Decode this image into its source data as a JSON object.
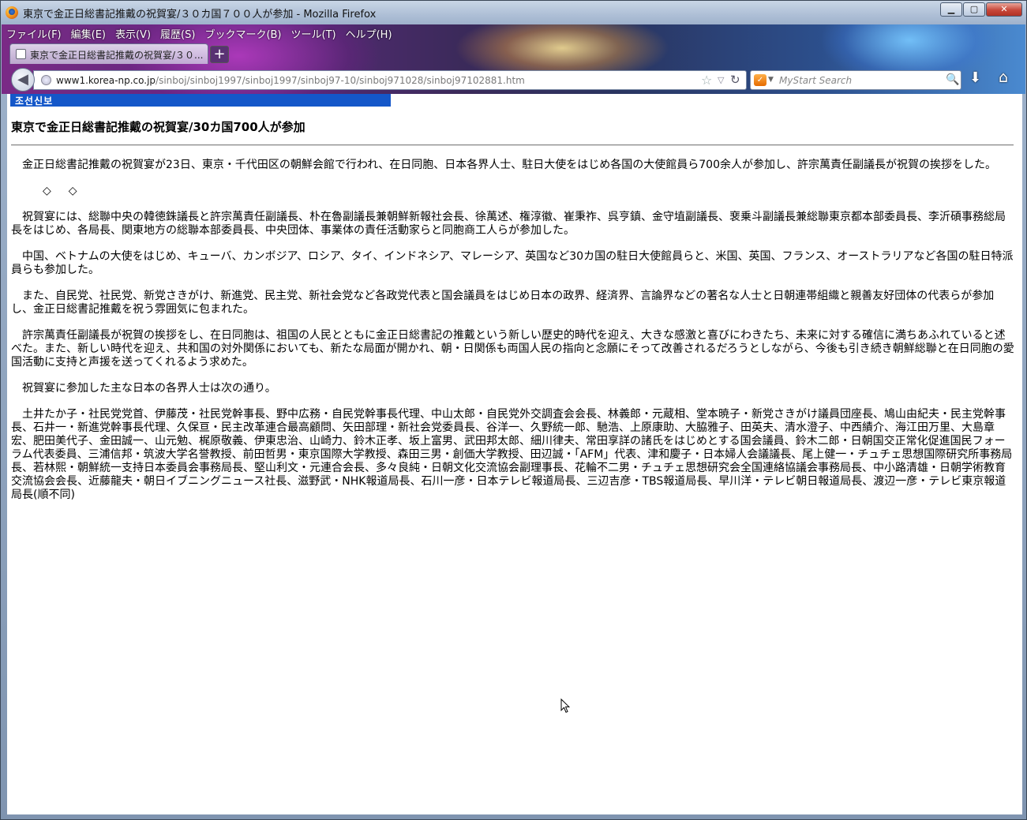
{
  "window": {
    "title": "東京で金正日総書記推戴の祝賀宴/３０カ国７００人が参加 - Mozilla Firefox",
    "minimize_glyph": "▁",
    "maximize_glyph": "▢",
    "close_glyph": "✕"
  },
  "menubar": {
    "items": [
      "ファイル(F)",
      "編集(E)",
      "表示(V)",
      "履歴(S)",
      "ブックマーク(B)",
      "ツール(T)",
      "ヘルプ(H)"
    ]
  },
  "tabs": [
    {
      "label": "東京で金正日総書記推戴の祝賀宴/３０...",
      "active": true
    }
  ],
  "newtab_glyph": "+",
  "navbar": {
    "back_glyph": "◀",
    "url_host": "www1.korea-np.co.jp",
    "url_path": "/sinboj/sinboj1997/sinboj1997/sinboj97-10/sinboj971028/sinboj97102881.htm",
    "search_placeholder": "MyStart Search",
    "search_engine_glyph": "✓",
    "star_glyph": "☆",
    "dropdown_glyph": "▽",
    "reload_glyph": "↻",
    "search_go_glyph": "🔍",
    "download_glyph": "⬇",
    "home_glyph": "⌂"
  },
  "page": {
    "masthead": "조선신보",
    "headline": "東京で金正日総書記推戴の祝賀宴/30カ国700人が参加",
    "paragraphs": [
      "金正日総書記推戴の祝賀宴が23日、東京・千代田区の朝鮮会館で行われ、在日同胞、日本各界人士、駐日大使をはじめ各国の大使館員ら700余人が参加し、許宗萬責任副議長が祝賀の挨拶をした。",
      "◇◇",
      "祝賀宴には、総聯中央の韓徳銖議長と許宗萬責任副議長、朴在魯副議長兼朝鮮新報社会長、徐萬述、権淳徽、崔秉祚、呉亨鎮、金守埴副議長、裵乗斗副議長兼総聯東京都本部委員長、李沂碩事務総局長をはじめ、各局長、関東地方の総聯本部委員長、中央団体、事業体の責任活動家らと同胞商工人らが参加した。",
      "中国、ベトナムの大使をはじめ、キューバ、カンボジア、ロシア、タイ、インドネシア、マレーシア、英国など30カ国の駐日大使館員らと、米国、英国、フランス、オーストラリアなど各国の駐日特派員らも参加した。",
      "また、自民党、社民党、新党さきがけ、新進党、民主党、新社会党など各政党代表と国会議員をはじめ日本の政界、経済界、言論界などの著名な人士と日朝連帯組織と親善友好団体の代表らが参加し、金正日総書記推戴を祝う雰囲気に包まれた。",
      "許宗萬責任副議長が祝賀の挨拶をし、在日同胞は、祖国の人民とともに金正日総書記の推戴という新しい歴史的時代を迎え、大きな感激と喜びにわきたち、未来に対する確信に満ちあふれていると述べた。また、新しい時代を迎え、共和国の対外関係においても、新たな局面が開かれ、朝・日関係も両国人民の指向と念願にそって改善されるだろうとしながら、今後も引き続き朝鮮総聯と在日同胞の愛国活動に支持と声援を送ってくれるよう求めた。",
      "祝賀宴に参加した主な日本の各界人士は次の通り。",
      "土井たか子・社民党党首、伊藤茂・社民党幹事長、野中広務・自民党幹事長代理、中山太郎・自民党外交調査会会長、林義郎・元蔵相、堂本暁子・新党さきがけ議員団座長、鳩山由紀夫・民主党幹事長、石井一・新進党幹事長代理、久保亘・民主改革連合最高顧問、矢田部理・新社会党委員長、谷洋一、久野統一郎、馳浩、上原康助、大脇雅子、田英夫、清水澄子、中西績介、海江田万里、大島章宏、肥田美代子、金田誠一、山元勉、梶原敬義、伊東忠治、山崎力、鈴木正孝、坂上富男、武田邦太郎、細川律夫、常田享詳の諸氏をはじめとする国会議員、鈴木二郎・日朝国交正常化促進国民フォーラム代表委員、三浦信邦・筑波大学名誉教授、前田哲男・東京国際大学教授、森田三男・創価大学教授、田辺誠・「AFM」代表、津和慶子・日本婦人会議議長、尾上健一・チュチェ思想国際研究所事務局長、若林熙・朝鮮統一支持日本委員会事務局長、堅山利文・元連合会長、多々良純・日朝文化交流協会副理事長、花輪不二男・チュチェ思想研究会全国連絡協議会事務局長、中小路清雄・日朝学術教育交流協会会長、近藤龍夫・朝日イブニングニュース社長、滋野武・NHK報道局長、石川一彦・日本テレビ報道局長、三辺吉彦・TBS報道局長、早川洋・テレビ朝日報道局長、渡辺一彦・テレビ東京報道局長(順不同)"
    ]
  }
}
